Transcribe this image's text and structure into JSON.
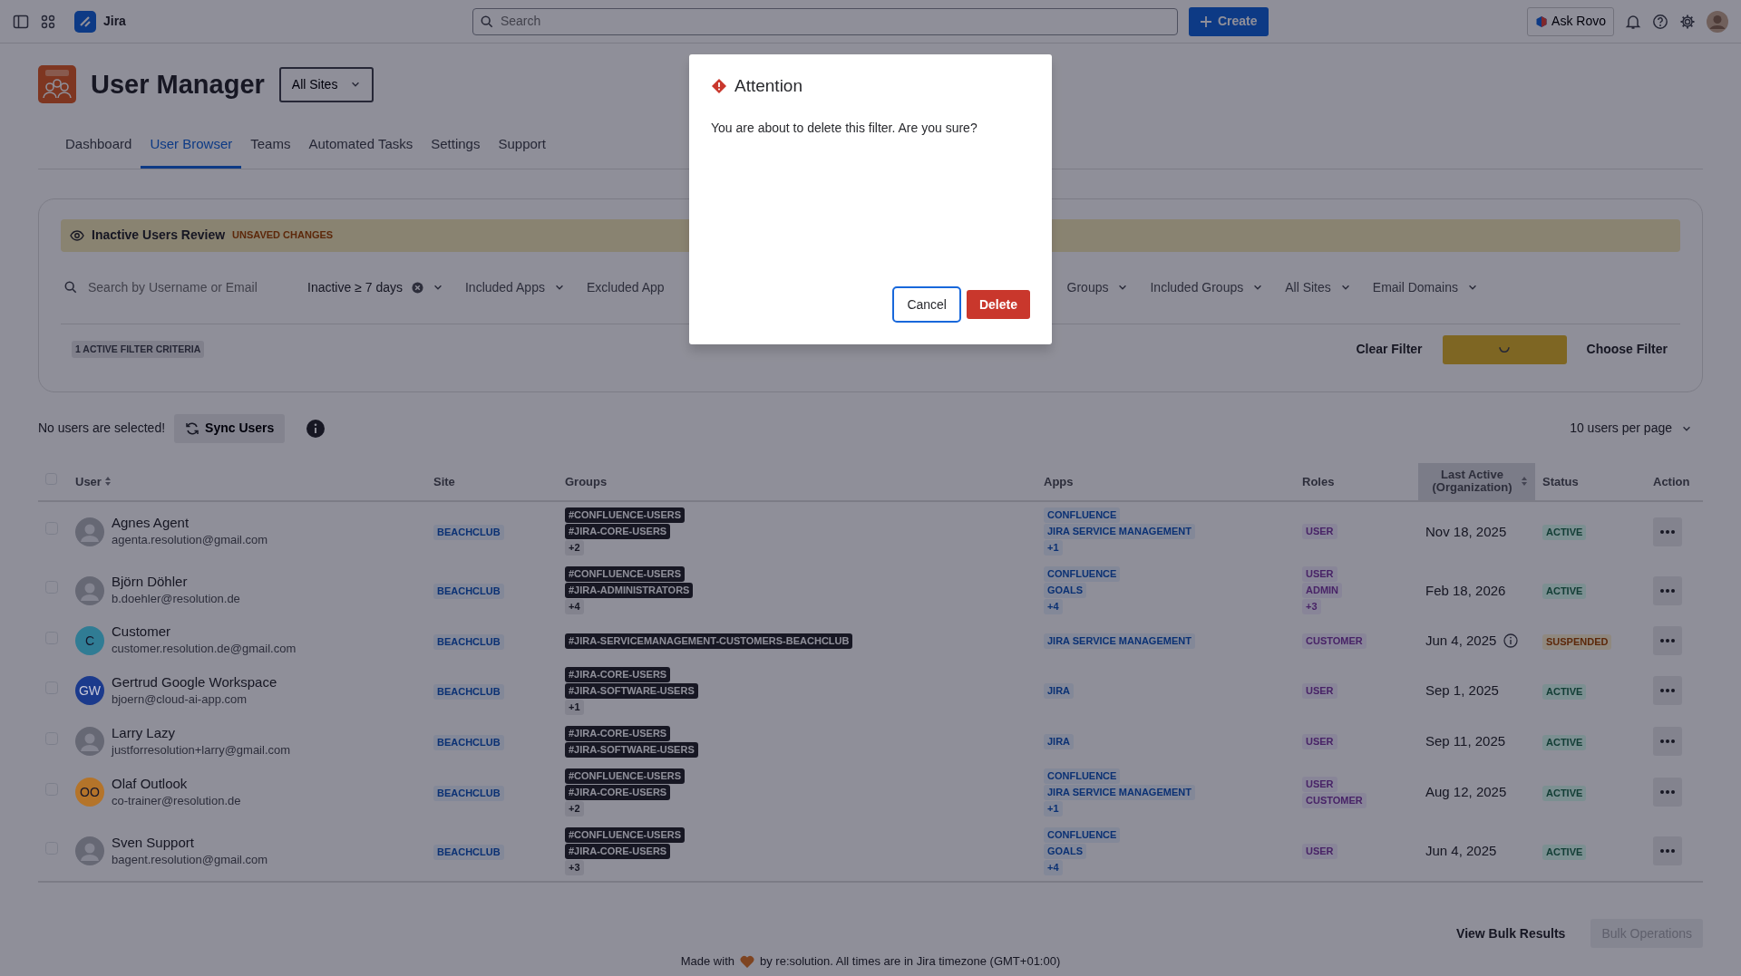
{
  "topbar": {
    "app_name": "Jira",
    "search": {
      "placeholder": "Search"
    },
    "create_button": "Create",
    "ask_button": "Ask Rovo"
  },
  "header": {
    "title": "User Manager",
    "site_select": "All Sites"
  },
  "tabs": [
    {
      "label": "Dashboard",
      "selected": false
    },
    {
      "label": "User Browser",
      "selected": true
    },
    {
      "label": "Teams",
      "selected": false
    },
    {
      "label": "Automated Tasks",
      "selected": false
    },
    {
      "label": "Settings",
      "selected": false
    },
    {
      "label": "Support",
      "selected": false
    }
  ],
  "filter_panel": {
    "name": "Inactive Users Review",
    "badge": "UNSAVED CHANGES",
    "search": {
      "placeholder": "Search by Username or Email"
    },
    "filters": [
      {
        "kind": "chip",
        "label": "Inactive ≥ 7 days"
      },
      {
        "kind": "dropdown",
        "label": "Included Apps"
      },
      {
        "kind": "cut",
        "label": "Excluded App"
      },
      {
        "kind": "dropdown",
        "label": "Groups"
      },
      {
        "kind": "dropdown",
        "label": "Included Groups"
      },
      {
        "kind": "dropdown",
        "label": "All Sites"
      },
      {
        "kind": "dropdown",
        "label": "Email Domains"
      }
    ],
    "criteria": "1 ACTIVE FILTER CRITERIA",
    "clear_button": "Clear Filter",
    "save_button": {
      "loading": true
    },
    "choose_button": "Choose Filter"
  },
  "toolbar": {
    "selection": "No users are selected!",
    "sync_button": "Sync Users",
    "page_size": "10 users per page"
  },
  "table": {
    "columns": [
      {
        "label": "User",
        "sortable": true,
        "active": false
      },
      {
        "label": "Site",
        "sortable": false,
        "active": false
      },
      {
        "label": "Groups",
        "sortable": false,
        "active": false
      },
      {
        "label": "Apps",
        "sortable": false,
        "active": false
      },
      {
        "label": "Roles",
        "sortable": false,
        "active": false
      },
      {
        "label": "Last Active (Organization)",
        "sortable": true,
        "active": true
      },
      {
        "label": "Status",
        "sortable": false,
        "active": false
      },
      {
        "label": "Action",
        "sortable": false,
        "active": false
      }
    ],
    "all_checked": false,
    "rows": [
      {
        "checked": false,
        "avatar": {
          "kind": "photo"
        },
        "name": "Agnes Agent",
        "email": "agenta.resolution@gmail.com",
        "site": "BEACHCLUB",
        "groups": [
          "#CONFLUENCE-USERS",
          "#JIRA-CORE-USERS"
        ],
        "groups_more": "+2",
        "apps": [
          "CONFLUENCE",
          "JIRA SERVICE MANAGEMENT"
        ],
        "apps_more": "+1",
        "roles": [
          "USER"
        ],
        "last_active": "Nov 18, 2025",
        "info": false,
        "status": {
          "kind": "active",
          "label": "ACTIVE"
        }
      },
      {
        "checked": false,
        "avatar": {
          "kind": "photo"
        },
        "name": "Björn Döhler",
        "email": "b.doehler@resolution.de",
        "site": "BEACHCLUB",
        "groups": [
          "#CONFLUENCE-USERS",
          "#JIRA-ADMINISTRATORS"
        ],
        "groups_more": "+4",
        "apps": [
          "CONFLUENCE",
          "GOALS"
        ],
        "apps_more": "+4",
        "roles": [
          "USER",
          "ADMIN"
        ],
        "roles_more": "+3",
        "last_active": "Feb 18, 2026",
        "info": false,
        "status": {
          "kind": "active",
          "label": "ACTIVE"
        }
      },
      {
        "checked": false,
        "avatar": {
          "kind": "initials",
          "initials": "C",
          "color": "#307c94"
        },
        "name": "Customer",
        "email": "customer.resolution.de@gmail.com",
        "site": "BEACHCLUB",
        "groups": [
          "#JIRA-SERVICEMANAGEMENT-CUSTOMERS-BEACHCLUB"
        ],
        "apps": [
          "JIRA SERVICE MANAGEMENT"
        ],
        "roles": [
          "CUSTOMER"
        ],
        "last_active": "Jun 4, 2025",
        "info": true,
        "status": {
          "kind": "suspended",
          "label": "SUSPENDED"
        }
      },
      {
        "checked": false,
        "avatar": {
          "kind": "initials",
          "initials": "GW",
          "color": "#1b3a8c"
        },
        "name": "Gertrud Google Workspace",
        "email": "bjoern@cloud-ai-app.com",
        "site": "BEACHCLUB",
        "groups": [
          "#JIRA-CORE-USERS",
          "#JIRA-SOFTWARE-USERS"
        ],
        "groups_more": "+1",
        "apps": [
          "JIRA"
        ],
        "roles": [
          "USER"
        ],
        "last_active": "Sep 1, 2025",
        "info": false,
        "status": {
          "kind": "active",
          "label": "ACTIVE"
        }
      },
      {
        "checked": false,
        "avatar": {
          "kind": "photo"
        },
        "name": "Larry Lazy",
        "email": "justforresolution+larry@gmail.com",
        "site": "BEACHCLUB",
        "groups": [
          "#JIRA-CORE-USERS",
          "#JIRA-SOFTWARE-USERS"
        ],
        "apps": [
          "JIRA"
        ],
        "roles": [
          "USER"
        ],
        "last_active": "Sep 11, 2025",
        "info": false,
        "status": {
          "kind": "active",
          "label": "ACTIVE"
        }
      },
      {
        "checked": false,
        "avatar": {
          "kind": "initials",
          "initials": "OO",
          "color": "#b4742a"
        },
        "name": "Olaf Outlook",
        "email": "co-trainer@resolution.de",
        "site": "BEACHCLUB",
        "groups": [
          "#CONFLUENCE-USERS",
          "#JIRA-CORE-USERS"
        ],
        "groups_more": "+2",
        "apps": [
          "CONFLUENCE",
          "JIRA SERVICE MANAGEMENT"
        ],
        "apps_more": "+1",
        "roles": [
          "USER",
          "CUSTOMER"
        ],
        "last_active": "Aug 12, 2025",
        "info": false,
        "status": {
          "kind": "active",
          "label": "ACTIVE"
        }
      },
      {
        "checked": false,
        "avatar": {
          "kind": "photo"
        },
        "name": "Sven Support",
        "email": "bagent.resolution@gmail.com",
        "site": "BEACHCLUB",
        "groups": [
          "#CONFLUENCE-USERS",
          "#JIRA-CORE-USERS"
        ],
        "groups_more": "+3",
        "apps": [
          "CONFLUENCE",
          "GOALS"
        ],
        "apps_more": "+4",
        "roles": [
          "USER"
        ],
        "last_active": "Jun 4, 2025",
        "info": false,
        "status": {
          "kind": "active",
          "label": "ACTIVE"
        }
      }
    ]
  },
  "footer": {
    "bulk_results": "View Bulk Results",
    "bulk_ops": {
      "label": "Bulk Operations",
      "disabled": true
    },
    "note_before": "Made with",
    "note_after": "by re:solution. All times are in Jira timezone (GMT+01:00)"
  },
  "modal": {
    "title": "Attention",
    "message": "You are about to delete this filter. Are you sure?",
    "buttons": [
      {
        "kind": "secondary",
        "label": "Cancel"
      },
      {
        "kind": "danger",
        "label": "Delete"
      }
    ]
  }
}
